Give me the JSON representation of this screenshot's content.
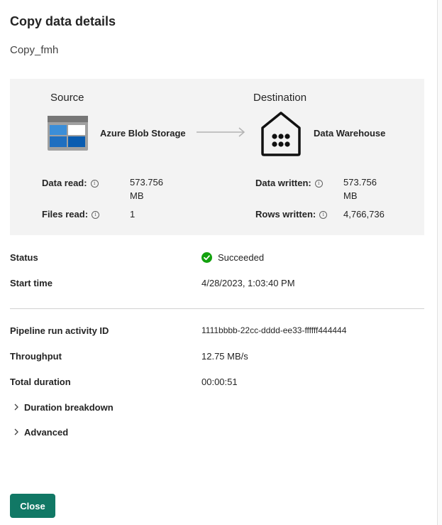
{
  "dialog": {
    "title": "Copy data details",
    "activity_name": "Copy_fmh"
  },
  "summary": {
    "source": {
      "heading": "Source",
      "name": "Azure Blob Storage",
      "icon": "azure-blob-storage-icon",
      "stats": [
        {
          "label": "Data read:",
          "value": "573.756 MB"
        },
        {
          "label": "Files read:",
          "value": "1"
        }
      ]
    },
    "destination": {
      "heading": "Destination",
      "name": "Data Warehouse",
      "icon": "data-warehouse-icon",
      "stats": [
        {
          "label": "Data written:",
          "value": "573.756 MB"
        },
        {
          "label": "Rows written:",
          "value": "4,766,736"
        }
      ]
    }
  },
  "details": {
    "status_label": "Status",
    "status_value": "Succeeded",
    "start_time_label": "Start time",
    "start_time_value": "4/28/2023, 1:03:40 PM",
    "run_id_label": "Pipeline run activity ID",
    "run_id_value": "1111bbbb-22cc-dddd-ee33-ffffff444444",
    "throughput_label": "Throughput",
    "throughput_value": "12.75 MB/s",
    "duration_label": "Total duration",
    "duration_value": "00:00:51"
  },
  "expanders": {
    "duration_breakdown": "Duration breakdown",
    "advanced": "Advanced"
  },
  "footer": {
    "close_label": "Close"
  },
  "colors": {
    "success": "#13a10e",
    "primary_button": "#117865",
    "card_background": "#f3f3f3"
  }
}
